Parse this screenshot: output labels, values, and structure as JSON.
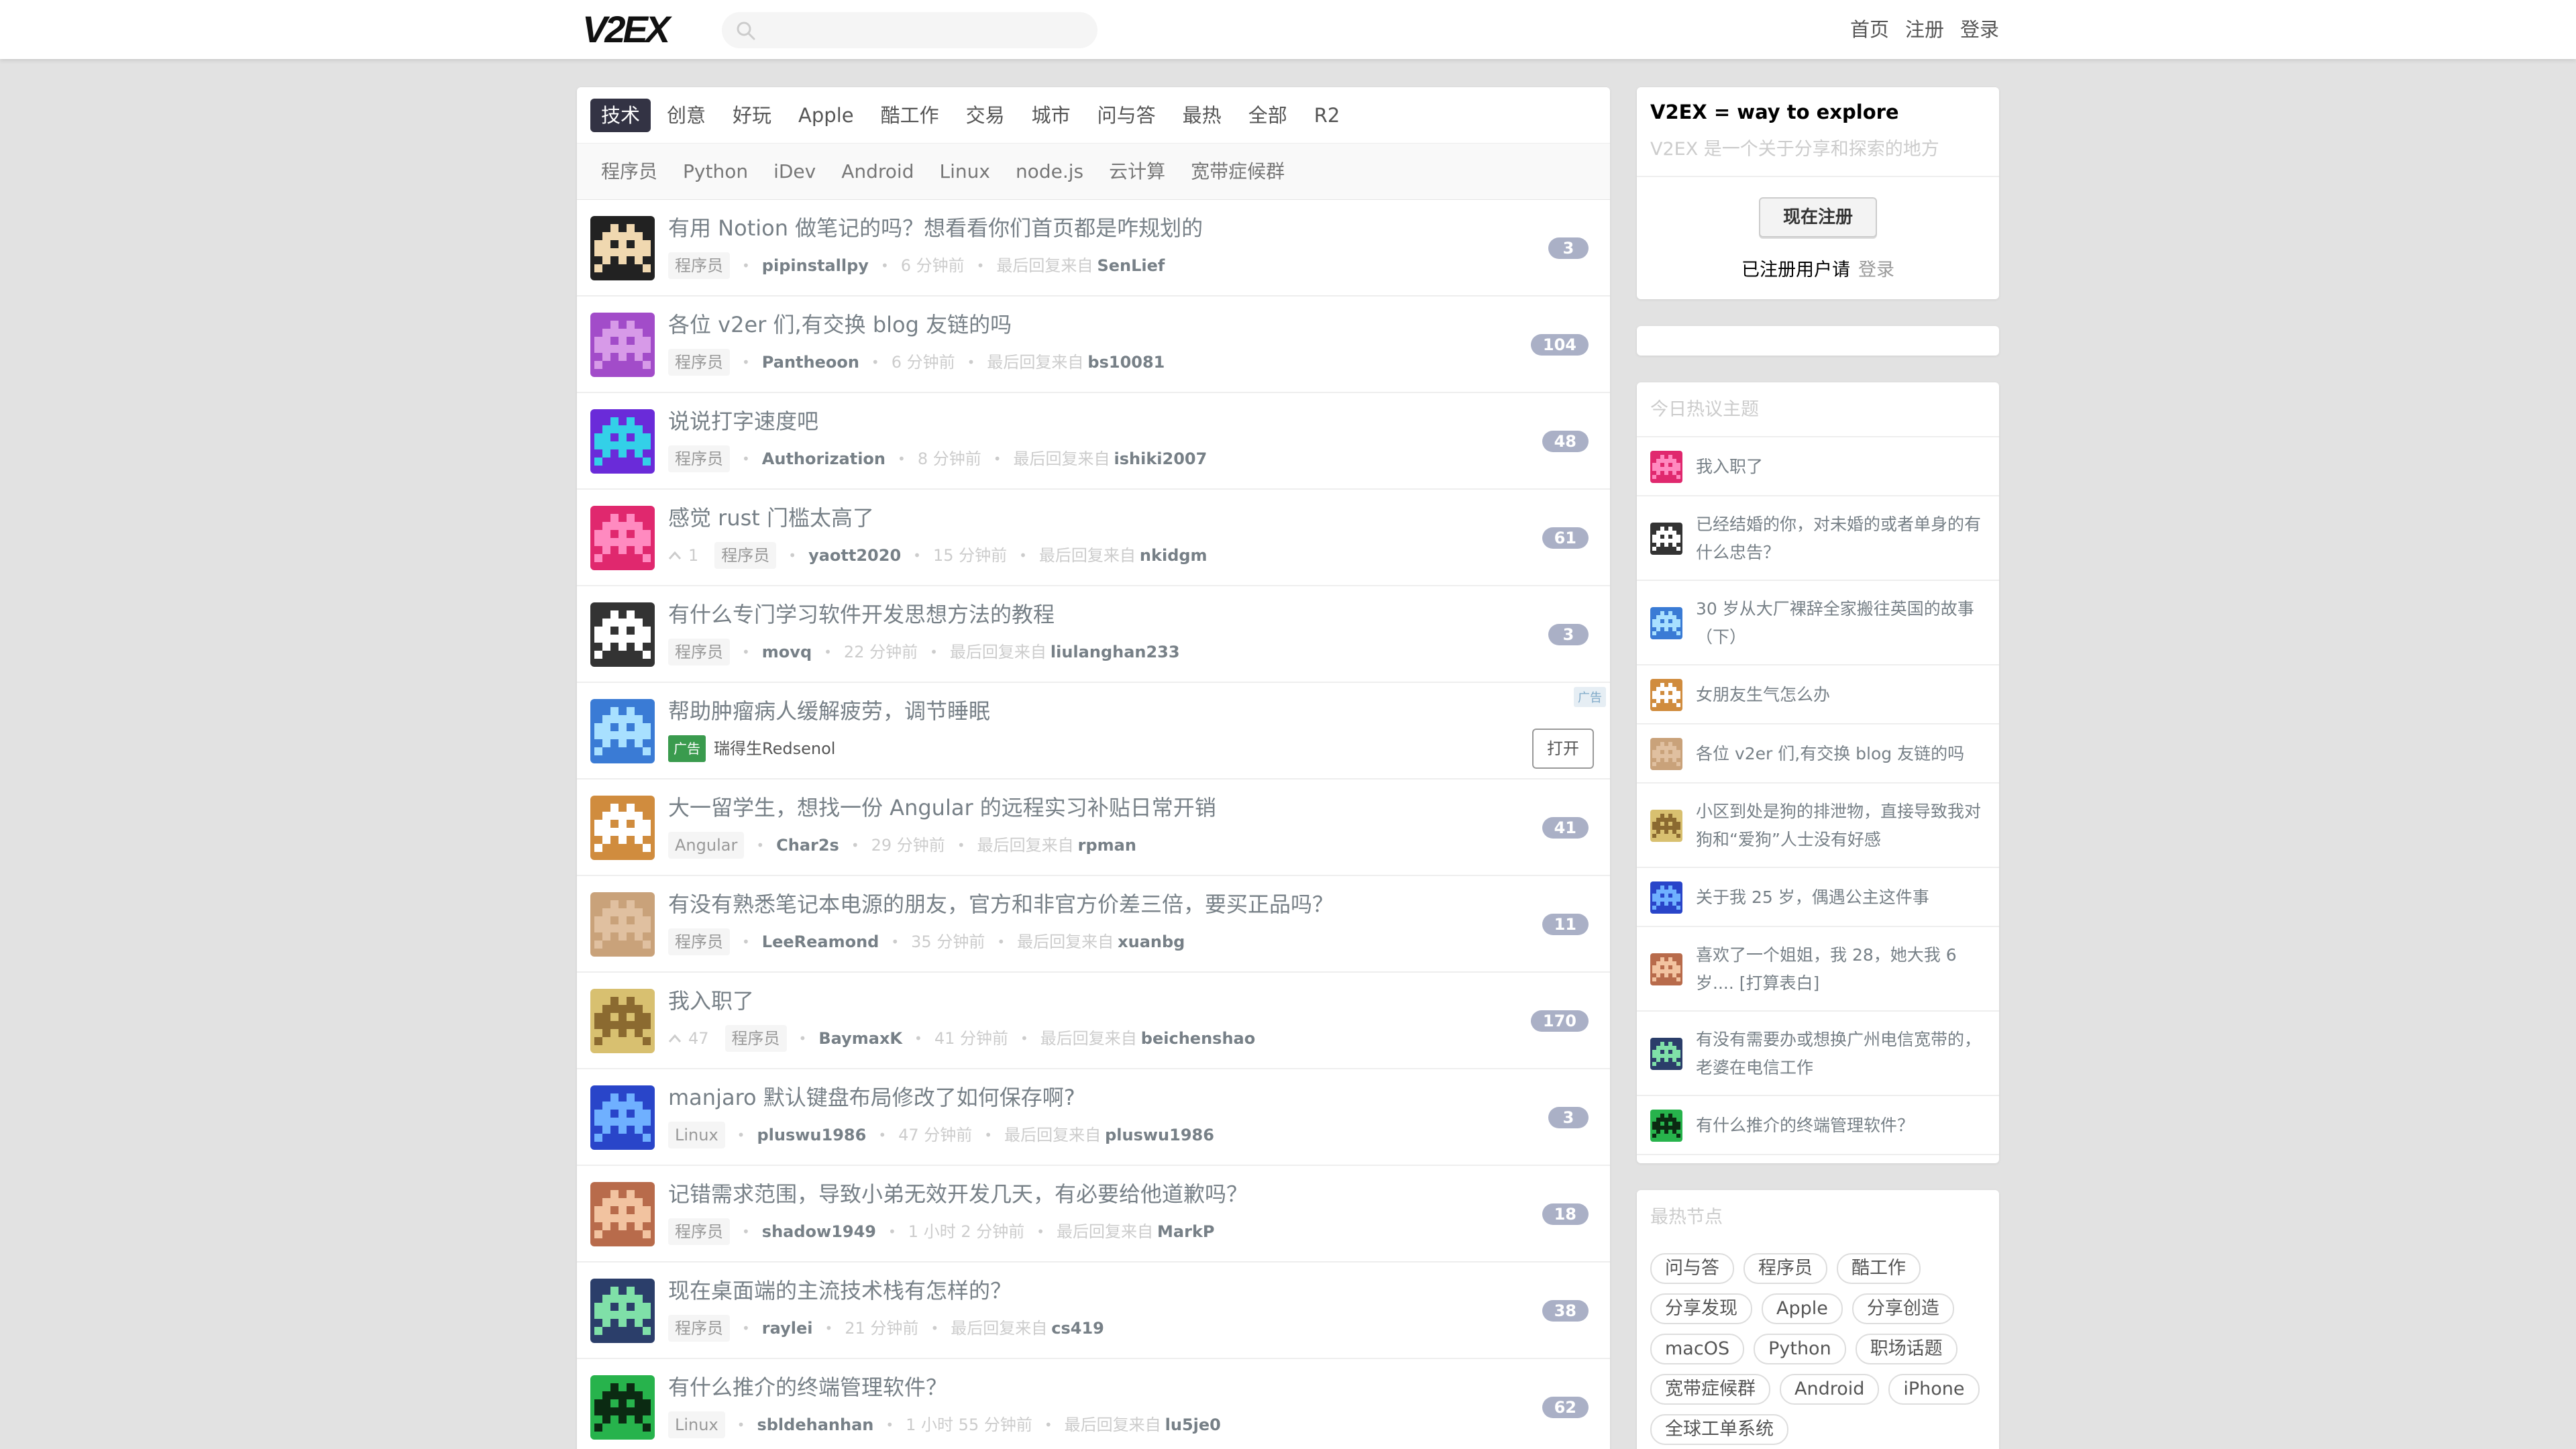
{
  "header": {
    "logo": "V2EX",
    "search_placeholder": "",
    "nav": [
      "首页",
      "注册",
      "登录"
    ]
  },
  "tabs": [
    "技术",
    "创意",
    "好玩",
    "Apple",
    "酷工作",
    "交易",
    "城市",
    "问与答",
    "最热",
    "全部",
    "R2"
  ],
  "active_tab": "技术",
  "subtabs": [
    "程序员",
    "Python",
    "iDev",
    "Android",
    "Linux",
    "node.js",
    "云计算",
    "宽带症候群"
  ],
  "labels": {
    "last_reply": "最后回复来自",
    "ad_badge": "广告",
    "ad_tag": "广告",
    "open_button": "打开"
  },
  "topics": [
    {
      "title": "有用 Notion 做笔记的吗？想看看你们首页都是咋规划的",
      "node": "程序员",
      "author": "pipinstallpy",
      "time": "6 分钟前",
      "last_user": "SenLief",
      "count": "3",
      "votes": ""
    },
    {
      "title": "各位 v2er 们,有交换 blog 友链的吗",
      "node": "程序员",
      "author": "Pantheoon",
      "time": "6 分钟前",
      "last_user": "bs10081",
      "count": "104",
      "votes": ""
    },
    {
      "title": "说说打字速度吧",
      "node": "程序员",
      "author": "Authorization",
      "time": "8 分钟前",
      "last_user": "ishiki2007",
      "count": "48",
      "votes": ""
    },
    {
      "title": "感觉 rust 门槛太高了",
      "node": "程序员",
      "author": "yaott2020",
      "time": "15 分钟前",
      "last_user": "nkidgm",
      "count": "61",
      "votes": "1"
    },
    {
      "title": "有什么专门学习软件开发思想方法的教程",
      "node": "程序员",
      "author": "movq",
      "time": "22 分钟前",
      "last_user": "liulanghan233",
      "count": "3",
      "votes": ""
    },
    {
      "title": "帮助肿瘤病人缓解疲劳，调节睡眠",
      "ad": true,
      "sponsor": "瑞得生Redsenol"
    },
    {
      "title": "大一留学生，想找一份 Angular 的远程实习补贴日常开销",
      "node": "Angular",
      "author": "Char2s",
      "time": "29 分钟前",
      "last_user": "rpman",
      "count": "41",
      "votes": ""
    },
    {
      "title": "有没有熟悉笔记本电源的朋友，官方和非官方价差三倍，要买正品吗？",
      "node": "程序员",
      "author": "LeeReamond",
      "time": "35 分钟前",
      "last_user": "xuanbg",
      "count": "11",
      "votes": ""
    },
    {
      "title": "我入职了",
      "node": "程序员",
      "author": "BaymaxK",
      "time": "41 分钟前",
      "last_user": "beichenshao",
      "count": "170",
      "votes": "47"
    },
    {
      "title": "manjaro 默认键盘布局修改了如何保存啊?",
      "node": "Linux",
      "author": "pluswu1986",
      "time": "47 分钟前",
      "last_user": "pluswu1986",
      "count": "3",
      "votes": ""
    },
    {
      "title": "记错需求范围，导致小弟无效开发几天，有必要给他道歉吗？",
      "node": "程序员",
      "author": "shadow1949",
      "time": "1 小时 2 分钟前",
      "last_user": "MarkP",
      "count": "18",
      "votes": ""
    },
    {
      "title": "现在桌面端的主流技术栈有怎样的？",
      "node": "程序员",
      "author": "raylei",
      "time": "21 分钟前",
      "last_user": "cs419",
      "count": "38",
      "votes": ""
    },
    {
      "title": "有什么推介的终端管理软件？",
      "node": "Linux",
      "author": "sbldehanhan",
      "time": "1 小时 55 分钟前",
      "last_user": "lu5je0",
      "count": "62",
      "votes": ""
    }
  ],
  "sidebar": {
    "welcome_title": "V2EX = way to explore",
    "welcome_sub": "V2EX 是一个关于分享和探索的地方",
    "signup_button": "现在注册",
    "registered_text": "已注册用户请",
    "login_link": "登录",
    "hot_header": "今日热议主题",
    "hot_topics": [
      "我入职了",
      "已经结婚的你，对未婚的或者单身的有什么忠告？",
      "30 岁从大厂裸辞全家搬往英国的故事（下）",
      "女朋友生气怎么办",
      "各位 v2er 们,有交换 blog 友链的吗",
      "小区到处是狗的排泄物，直接导致我对狗和“爱狗”人士没有好感",
      "关于我 25 岁，偶遇公主这件事",
      "喜欢了一个姐姐，我 28，她大我 6 岁.... [打算表白]",
      "有没有需要办或想换广州电信宽带的，老婆在电信工作",
      "有什么推介的终端管理软件？"
    ],
    "nodes_header": "最热节点",
    "hot_nodes": [
      "问与答",
      "程序员",
      "酷工作",
      "分享发现",
      "Apple",
      "分享创造",
      "macOS",
      "Python",
      "职场话题",
      "宽带症候群",
      "Android",
      "iPhone",
      "全球工单系统"
    ]
  }
}
